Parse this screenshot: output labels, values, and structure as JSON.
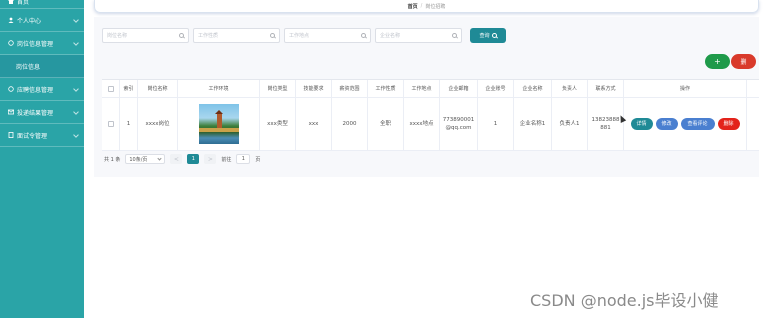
{
  "sidebar": {
    "items": [
      {
        "label": "首页",
        "icon": "home-icon"
      },
      {
        "label": "个人中心",
        "icon": "person-icon"
      },
      {
        "label": "岗位信息管理",
        "icon": "circle-icon"
      },
      {
        "label": "岗位信息",
        "icon": ""
      },
      {
        "label": "应聘信息管理",
        "icon": "circle-icon"
      },
      {
        "label": "投递结果管理",
        "icon": "mail-icon"
      },
      {
        "label": "面试令管理",
        "icon": "doc-icon"
      }
    ]
  },
  "breadcrumb": {
    "home": "首页",
    "sep": "/",
    "current": "岗位招聘"
  },
  "search": {
    "p1": "岗位名称",
    "p2": "工作性质",
    "p3": "工作地点",
    "p4": "企业名称",
    "button": "查询"
  },
  "actions": {
    "add": "+",
    "delete": "删"
  },
  "table": {
    "headers": [
      "",
      "索引",
      "岗位名称",
      "工作环境",
      "岗位类型",
      "技能要求",
      "薪资范围",
      "工作性质",
      "工作地点",
      "企业邮箱",
      "企业账号",
      "企业名称",
      "负责人",
      "联系方式",
      "操作"
    ],
    "rows": [
      {
        "index": "1",
        "name": "xxxx岗位",
        "type": "xxx类型",
        "skill": "xxx",
        "salary": "2000",
        "nature": "全职",
        "place": "xxxx地点",
        "email": "773890001@qq.com",
        "account": "1",
        "company": "企业名称1",
        "manager": "负责人1",
        "phone": "13823888881"
      }
    ],
    "ops": {
      "detail": "详情",
      "edit": "修改",
      "review": "查看评论",
      "delete": "删除"
    }
  },
  "pager": {
    "total": "共 1 条",
    "size": "10条/页",
    "prev": "<",
    "page": "1",
    "next": ">",
    "goto": "前往",
    "goto_value": "1",
    "unit": "页"
  },
  "watermark": "CSDN @node.js毕设小健",
  "colors": {
    "sidebar": "#2aa4a7",
    "accent": "#1f8a96",
    "danger": "#e3231b",
    "primary": "#4a7fd0",
    "success": "#1f9a4a"
  }
}
